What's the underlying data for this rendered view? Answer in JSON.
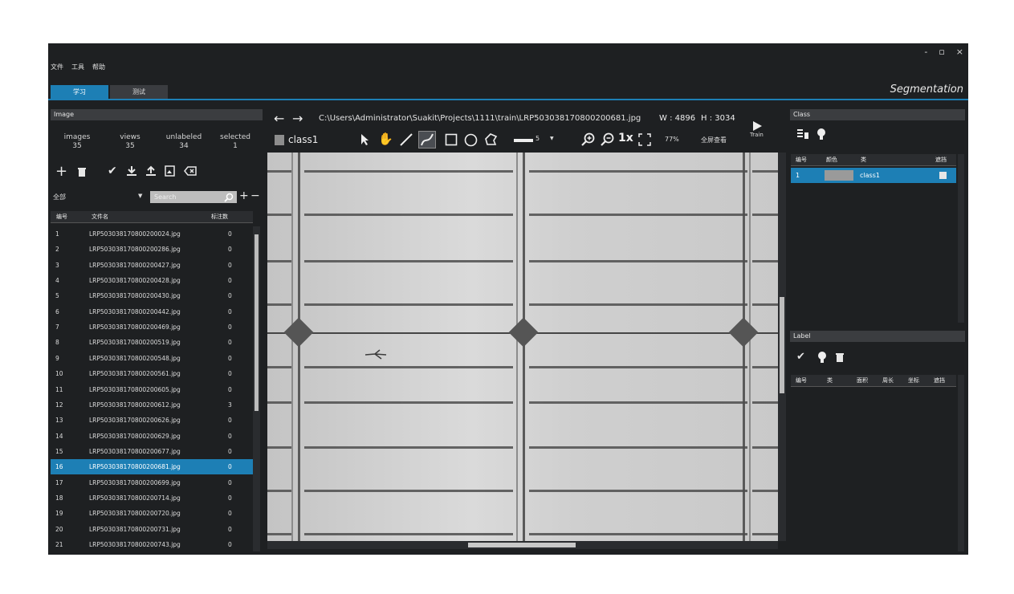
{
  "window": {
    "minimize": "-",
    "restore": "▫",
    "close": "×"
  },
  "menu": {
    "file": "文件",
    "tools": "工具",
    "help": "帮助"
  },
  "tabs": [
    {
      "label": "学习"
    },
    {
      "label": "测试"
    }
  ],
  "app_title": "Segmentation",
  "image_panel": {
    "title": "Image",
    "stats": [
      {
        "label": "images",
        "value": "35"
      },
      {
        "label": "views",
        "value": "35"
      },
      {
        "label": "unlabeled",
        "value": "34"
      },
      {
        "label": "selected",
        "value": "1"
      }
    ],
    "filter": "全部",
    "search_placeholder": "Search",
    "columns": {
      "id": "编号",
      "filename": "文件名",
      "count": "标注数"
    },
    "rows": [
      {
        "id": "1",
        "name": "LRP503038170800200024.jpg",
        "count": "0"
      },
      {
        "id": "2",
        "name": "LRP503038170800200286.jpg",
        "count": "0"
      },
      {
        "id": "3",
        "name": "LRP503038170800200427.jpg",
        "count": "0"
      },
      {
        "id": "4",
        "name": "LRP503038170800200428.jpg",
        "count": "0"
      },
      {
        "id": "5",
        "name": "LRP503038170800200430.jpg",
        "count": "0"
      },
      {
        "id": "6",
        "name": "LRP503038170800200442.jpg",
        "count": "0"
      },
      {
        "id": "7",
        "name": "LRP503038170800200469.jpg",
        "count": "0"
      },
      {
        "id": "8",
        "name": "LRP503038170800200519.jpg",
        "count": "0"
      },
      {
        "id": "9",
        "name": "LRP503038170800200548.jpg",
        "count": "0"
      },
      {
        "id": "10",
        "name": "LRP503038170800200561.jpg",
        "count": "0"
      },
      {
        "id": "11",
        "name": "LRP503038170800200605.jpg",
        "count": "0"
      },
      {
        "id": "12",
        "name": "LRP503038170800200612.jpg",
        "count": "3"
      },
      {
        "id": "13",
        "name": "LRP503038170800200626.jpg",
        "count": "0"
      },
      {
        "id": "14",
        "name": "LRP503038170800200629.jpg",
        "count": "0"
      },
      {
        "id": "15",
        "name": "LRP503038170800200677.jpg",
        "count": "0"
      },
      {
        "id": "16",
        "name": "LRP503038170800200681.jpg",
        "count": "0",
        "selected": true
      },
      {
        "id": "17",
        "name": "LRP503038170800200699.jpg",
        "count": "0"
      },
      {
        "id": "18",
        "name": "LRP503038170800200714.jpg",
        "count": "0"
      },
      {
        "id": "19",
        "name": "LRP503038170800200720.jpg",
        "count": "0"
      },
      {
        "id": "20",
        "name": "LRP503038170800200731.jpg",
        "count": "0"
      },
      {
        "id": "21",
        "name": "LRP503038170800200743.jpg",
        "count": "0"
      }
    ]
  },
  "viewer": {
    "path": "C:\\Users\\Administrator\\Suakit\\Projects\\1111\\train\\LRP503038170800200681.jpg",
    "width_label": "W : 4896",
    "height_label": "H : 3034",
    "current_class": "class1",
    "brush_size": "5",
    "zoom_1x": "1x",
    "zoom_percent": "77%",
    "fullscreen_label": "全屏查看",
    "train_label": "Train"
  },
  "class_panel": {
    "title": "Class",
    "columns": {
      "id": "编号",
      "color": "颜色",
      "class": "类",
      "visible": "遮挡"
    },
    "rows": [
      {
        "id": "1",
        "name": "class1",
        "color": "#9a9a9a"
      }
    ]
  },
  "label_panel": {
    "title": "Label",
    "columns": {
      "id": "编号",
      "class": "类",
      "area": "面积",
      "perimeter": "周长",
      "coords": "坐标",
      "visible": "遮挡"
    }
  },
  "colors": {
    "accent": "#1d7fb5",
    "background": "#1e2022",
    "panel_header": "#3b3d40"
  }
}
